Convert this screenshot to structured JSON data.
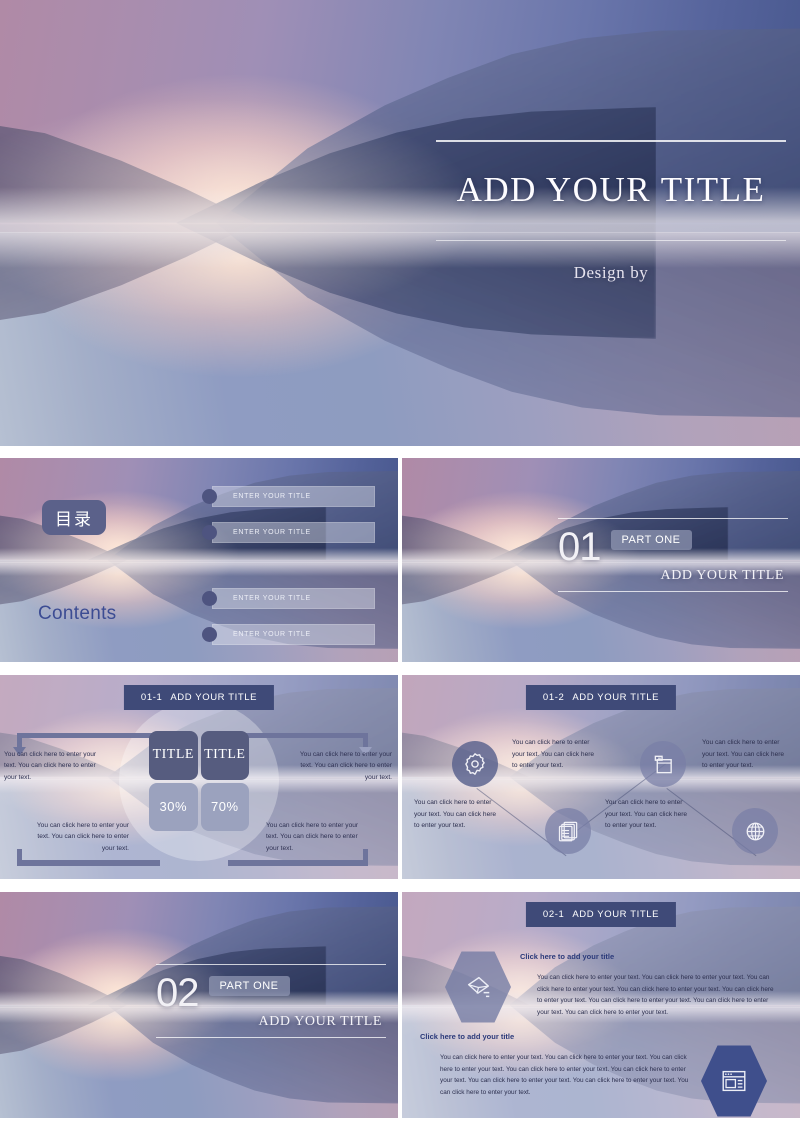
{
  "slide_title": {
    "title": "ADD YOUR TITLE",
    "subtitle": "Design by"
  },
  "slide_contents": {
    "heading_cn": "目录",
    "heading_en": "Contents",
    "items": [
      {
        "label": "ENTER YOUR TITLE"
      },
      {
        "label": "ENTER YOUR TITLE"
      },
      {
        "label": "ENTER YOUR TITLE"
      },
      {
        "label": "ENTER YOUR TITLE"
      }
    ]
  },
  "slide_section_01": {
    "number": "01",
    "part": "PART ONE",
    "title": "ADD YOUR TITLE"
  },
  "slide_section_02": {
    "number": "02",
    "part": "PART ONE",
    "title": "ADD YOUR TITLE"
  },
  "slide_diagram": {
    "header_num": "01-1",
    "header_title": "ADD YOUR TITLE",
    "cells": [
      {
        "label": "TITLE"
      },
      {
        "label": "TITLE"
      },
      {
        "label": "30%"
      },
      {
        "label": "70%"
      }
    ],
    "body": "You can click here to enter your text. You can click here to enter your text.",
    "texts": {
      "top_left": "You can click here to enter your text. You can click here to enter your text.",
      "top_right": "You can click here to enter your text. You can click here to enter your text.",
      "bottom_left": "You can click here to enter your text. You can click here to enter your text.",
      "bottom_right": "You can click here to enter your text. You can click here to enter your text."
    }
  },
  "slide_icons": {
    "header_num": "01-2",
    "header_title": "ADD YOUR TITLE",
    "items": [
      {
        "icon": "gear-icon",
        "text": "You can click here to enter your text. You can click here to enter your text."
      },
      {
        "icon": "documents-icon",
        "text": "You can click here to enter your text. You can click here to enter your text."
      },
      {
        "icon": "folder-icon",
        "text": "You can click here to enter your text. You can click here to enter your text."
      },
      {
        "icon": "globe-icon",
        "text": "You can click here to enter your text. You can click here to enter your text."
      }
    ]
  },
  "slide_hex": {
    "header_num": "02-1",
    "header_title": "ADD YOUR TITLE",
    "blocks": [
      {
        "icon": "mail-send-icon",
        "title": "Click here to add your title",
        "body": "You can click here to enter your text. You can click here to enter your text. You can click here to enter your text. You can click here to enter your text. You can click here to enter your text. You can click here to enter your text. You can click here to enter your text. You can click here to enter your text."
      },
      {
        "icon": "browser-layout-icon",
        "title": "Click here to add your title",
        "body": "You can click here to enter your text. You can click here to enter your text. You can click here to enter your text. You can click here to enter your text. You can click here to enter your text. You can click here to enter your text. You can click here to enter your text. You can click here to enter your text."
      }
    ]
  },
  "colors": {
    "badge_dark": "#3f4a78",
    "cell_dark": "#565c7f",
    "cell_light": "#9ba2be",
    "accent_blue": "#3c4c93",
    "hex_solid": "#3f4f8c"
  }
}
